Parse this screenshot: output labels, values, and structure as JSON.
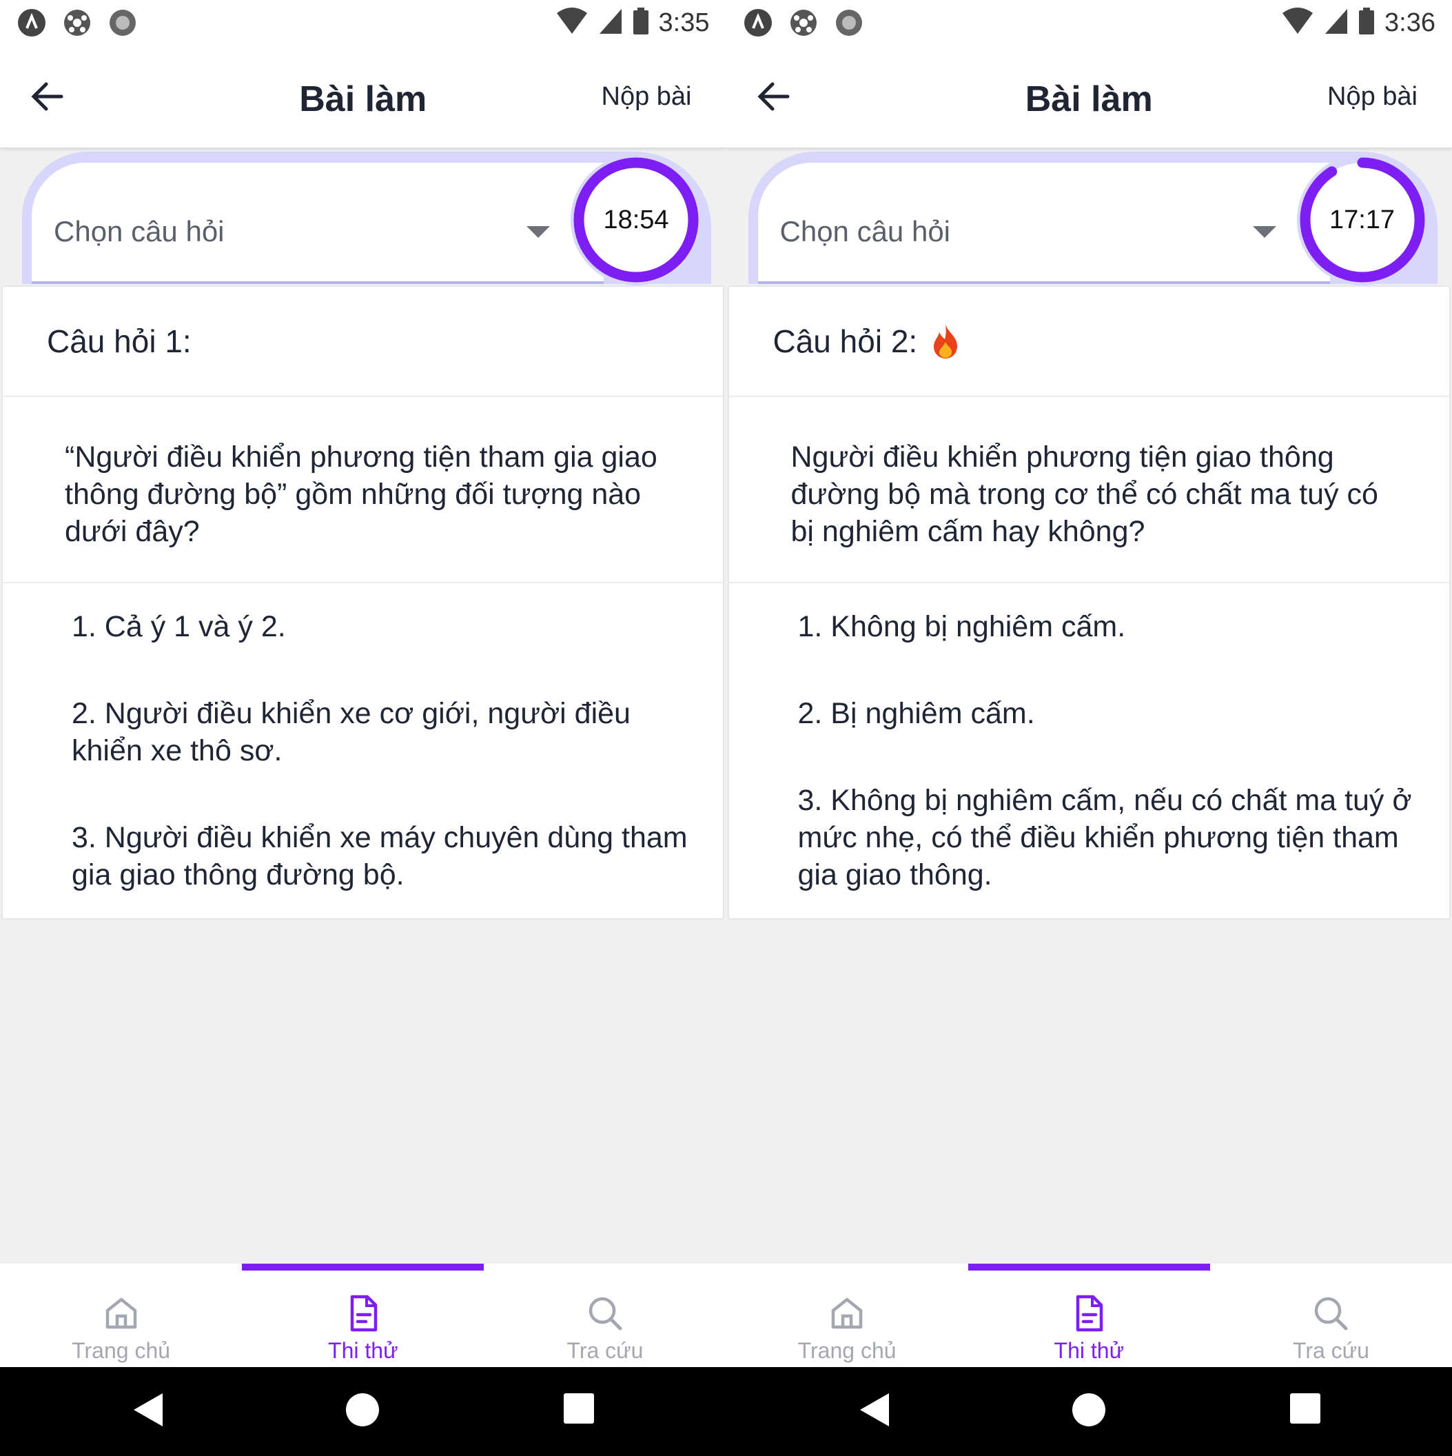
{
  "screens": [
    {
      "status": {
        "time": "3:35"
      },
      "appbar": {
        "title": "Bài làm",
        "submit": "Nộp bài"
      },
      "selector": {
        "placeholder": "Chọn câu hỏi",
        "timer": "18:54",
        "timer_progress": 1.0
      },
      "question": {
        "number": "Câu hỏi 1:",
        "hot": false,
        "text": "“Người điều khiển phương tiện tham gia giao thông đường bộ” gồm những đối tượng nào dưới đây?",
        "answers": [
          "1. Cả ý 1 và ý 2.",
          "2. Người điều khiển xe cơ giới, người điều khiển xe thô sơ.",
          "3. Người điều khiển xe máy chuyên dùng tham gia giao thông đường bộ."
        ]
      },
      "nav": {
        "home": "Trang chủ",
        "test": "Thi thử",
        "search": "Tra cứu",
        "active": "test"
      }
    },
    {
      "status": {
        "time": "3:36"
      },
      "appbar": {
        "title": "Bài làm",
        "submit": "Nộp bài"
      },
      "selector": {
        "placeholder": "Chọn câu hỏi",
        "timer": "17:17",
        "timer_progress": 0.91
      },
      "question": {
        "number": "Câu hỏi 2:",
        "hot": true,
        "text": "Người điều khiển phương tiện giao thông đường bộ mà trong cơ thể có chất ma tuý có bị nghiêm cấm hay không?",
        "answers": [
          "1. Không bị nghiêm cấm.",
          "2. Bị nghiêm cấm.",
          "3. Không bị nghiêm cấm, nếu có chất ma tuý ở mức nhẹ, có thể điều khiển phương tiện tham gia giao thông."
        ]
      },
      "nav": {
        "home": "Trang chủ",
        "test": "Thi thử",
        "search": "Tra cứu",
        "active": "test"
      }
    }
  ],
  "colors": {
    "accent": "#7d1ff2",
    "ring_track": "#d8d6fb",
    "text": "#1f2535",
    "muted": "#a4a7b0"
  },
  "icons": [
    "back-arrow-icon",
    "dropdown-caret-icon",
    "fire-icon",
    "home-icon",
    "document-icon",
    "search-icon",
    "nav-back-icon",
    "nav-home-icon",
    "nav-recents-icon"
  ]
}
